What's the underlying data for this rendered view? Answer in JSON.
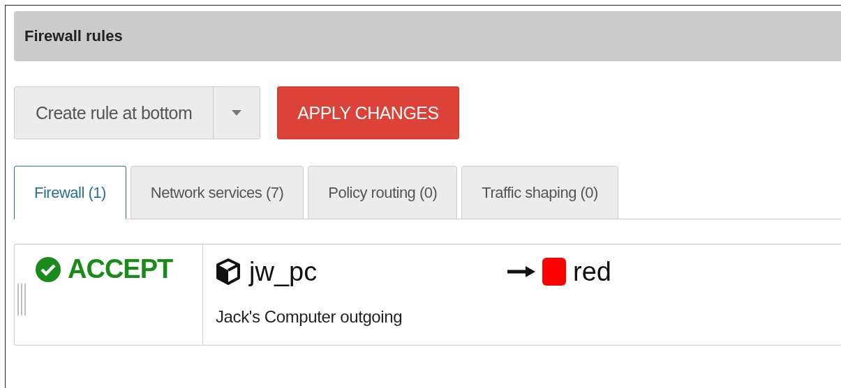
{
  "panel": {
    "title": "Firewall rules"
  },
  "toolbar": {
    "create_button": "Create rule at bottom",
    "apply_button": "APPLY CHANGES"
  },
  "tabs": [
    {
      "label": "Firewall (1)",
      "selected": true
    },
    {
      "label": "Network services (7)",
      "selected": false
    },
    {
      "label": "Policy routing (0)",
      "selected": false
    },
    {
      "label": "Traffic shaping (0)",
      "selected": false
    }
  ],
  "rules": [
    {
      "action": "ACCEPT",
      "kind": "accept",
      "source": "jw_pc",
      "destination": {
        "name": "red",
        "color": "#ff0000"
      },
      "description": "Jack's Computer outgoing"
    }
  ]
}
